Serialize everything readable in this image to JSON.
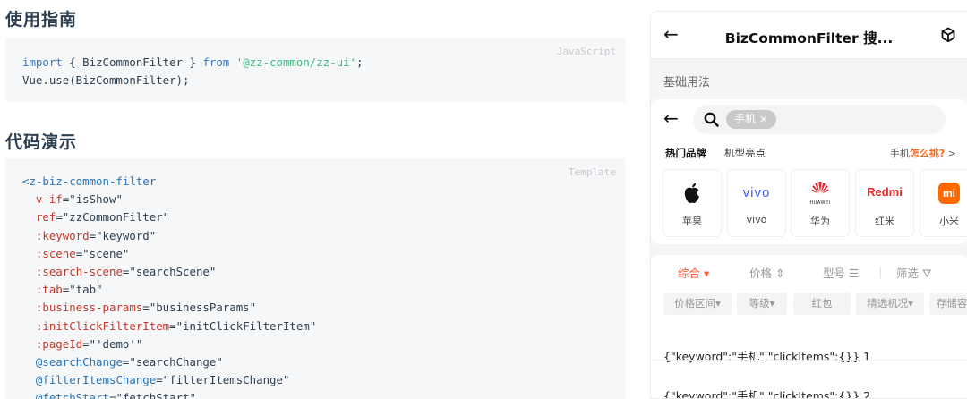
{
  "doc": {
    "usage_title": "使用指南",
    "demo_title": "代码演示",
    "usage_code": {
      "lang": "JavaScript",
      "line1": {
        "kw1": "import",
        "mid": " { BizCommonFilter } ",
        "kw2": "from",
        "sp": " ",
        "str": "'@zz-common/zz-ui'",
        "end": ";"
      },
      "line2": "Vue.use(BizCommonFilter);"
    },
    "demo_code": {
      "lang": "Template",
      "open_tag": "<z-biz-common-filter",
      "attrs": [
        {
          "name": "v-if",
          "value": "\"isShow\""
        },
        {
          "name": "ref",
          "value": "\"zzCommonFilter\""
        },
        {
          "name": ":keyword",
          "value": "\"keyword\""
        },
        {
          "name": ":scene",
          "value": "\"scene\""
        },
        {
          "name": ":search-scene",
          "value": "\"searchScene\""
        },
        {
          "name": ":tab",
          "value": "\"tab\""
        },
        {
          "name": ":business-params",
          "value": "\"businessParams\""
        },
        {
          "name": ":initClickFilterItem",
          "value": "\"initClickFilterItem\""
        },
        {
          "name": ":pageId",
          "value": "\"'demo'\""
        },
        {
          "name": "@searchChange",
          "value": "\"searchChange\""
        },
        {
          "name": "@filterItemsChange",
          "value": "\"filterItemsChange\""
        },
        {
          "name": "@fetchStart",
          "value": "\"fetchStart\""
        }
      ]
    }
  },
  "phone": {
    "nav_title": "BizCommonFilter 搜...",
    "section_label": "基础用法",
    "search_chip": "手机 ×",
    "brand_tab_active": "热门品牌",
    "brand_tab": "机型亮点",
    "brand_hint_prefix": "手机",
    "brand_hint_emph": "怎么挑?",
    "brand_hint_arrow": " >",
    "brands": [
      {
        "name": "苹果",
        "logo": ""
      },
      {
        "name": "vivo",
        "logo": "vivo"
      },
      {
        "name": "华为",
        "logo": "HUAWEI"
      },
      {
        "name": "红米",
        "logo": "Redmi"
      },
      {
        "name": "小米",
        "logo": "mi"
      }
    ],
    "sort_options": [
      {
        "label": "综合 ▾",
        "active": true
      },
      {
        "label": "价格 ⇕",
        "active": false
      },
      {
        "label": "型号 ☰",
        "active": false
      },
      {
        "label": "筛选 ⛛",
        "active": false
      }
    ],
    "filter_pills": [
      "价格区间▾",
      "等级▾",
      "红包",
      "精选机况▾",
      "存储容"
    ],
    "results": [
      "{\"keyword\":\"手机\",\"clickItems\":{}} 1",
      "{\"keyword\":\"手机\",\"clickItems\":{}} 2"
    ]
  }
}
